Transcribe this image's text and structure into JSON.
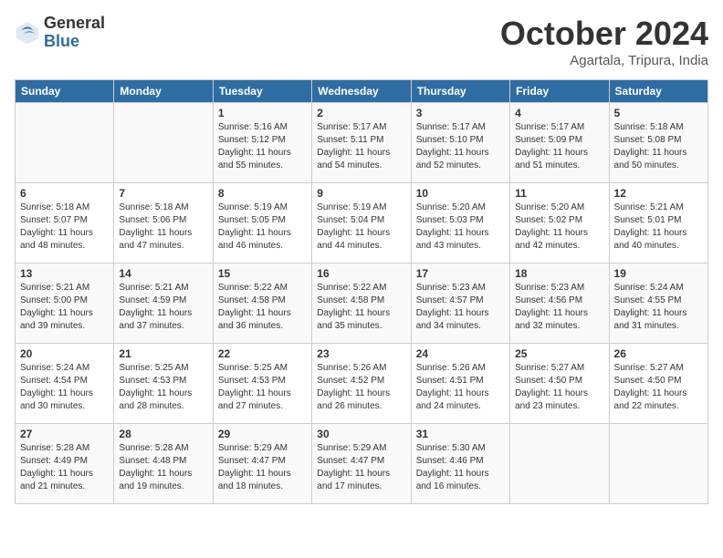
{
  "header": {
    "logo_general": "General",
    "logo_blue": "Blue",
    "month_title": "October 2024",
    "subtitle": "Agartala, Tripura, India"
  },
  "days_of_week": [
    "Sunday",
    "Monday",
    "Tuesday",
    "Wednesday",
    "Thursday",
    "Friday",
    "Saturday"
  ],
  "weeks": [
    [
      {
        "day": "",
        "content": ""
      },
      {
        "day": "",
        "content": ""
      },
      {
        "day": "1",
        "content": "Sunrise: 5:16 AM\nSunset: 5:12 PM\nDaylight: 11 hours and 55 minutes."
      },
      {
        "day": "2",
        "content": "Sunrise: 5:17 AM\nSunset: 5:11 PM\nDaylight: 11 hours and 54 minutes."
      },
      {
        "day": "3",
        "content": "Sunrise: 5:17 AM\nSunset: 5:10 PM\nDaylight: 11 hours and 52 minutes."
      },
      {
        "day": "4",
        "content": "Sunrise: 5:17 AM\nSunset: 5:09 PM\nDaylight: 11 hours and 51 minutes."
      },
      {
        "day": "5",
        "content": "Sunrise: 5:18 AM\nSunset: 5:08 PM\nDaylight: 11 hours and 50 minutes."
      }
    ],
    [
      {
        "day": "6",
        "content": "Sunrise: 5:18 AM\nSunset: 5:07 PM\nDaylight: 11 hours and 48 minutes."
      },
      {
        "day": "7",
        "content": "Sunrise: 5:18 AM\nSunset: 5:06 PM\nDaylight: 11 hours and 47 minutes."
      },
      {
        "day": "8",
        "content": "Sunrise: 5:19 AM\nSunset: 5:05 PM\nDaylight: 11 hours and 46 minutes."
      },
      {
        "day": "9",
        "content": "Sunrise: 5:19 AM\nSunset: 5:04 PM\nDaylight: 11 hours and 44 minutes."
      },
      {
        "day": "10",
        "content": "Sunrise: 5:20 AM\nSunset: 5:03 PM\nDaylight: 11 hours and 43 minutes."
      },
      {
        "day": "11",
        "content": "Sunrise: 5:20 AM\nSunset: 5:02 PM\nDaylight: 11 hours and 42 minutes."
      },
      {
        "day": "12",
        "content": "Sunrise: 5:21 AM\nSunset: 5:01 PM\nDaylight: 11 hours and 40 minutes."
      }
    ],
    [
      {
        "day": "13",
        "content": "Sunrise: 5:21 AM\nSunset: 5:00 PM\nDaylight: 11 hours and 39 minutes."
      },
      {
        "day": "14",
        "content": "Sunrise: 5:21 AM\nSunset: 4:59 PM\nDaylight: 11 hours and 37 minutes."
      },
      {
        "day": "15",
        "content": "Sunrise: 5:22 AM\nSunset: 4:58 PM\nDaylight: 11 hours and 36 minutes."
      },
      {
        "day": "16",
        "content": "Sunrise: 5:22 AM\nSunset: 4:58 PM\nDaylight: 11 hours and 35 minutes."
      },
      {
        "day": "17",
        "content": "Sunrise: 5:23 AM\nSunset: 4:57 PM\nDaylight: 11 hours and 34 minutes."
      },
      {
        "day": "18",
        "content": "Sunrise: 5:23 AM\nSunset: 4:56 PM\nDaylight: 11 hours and 32 minutes."
      },
      {
        "day": "19",
        "content": "Sunrise: 5:24 AM\nSunset: 4:55 PM\nDaylight: 11 hours and 31 minutes."
      }
    ],
    [
      {
        "day": "20",
        "content": "Sunrise: 5:24 AM\nSunset: 4:54 PM\nDaylight: 11 hours and 30 minutes."
      },
      {
        "day": "21",
        "content": "Sunrise: 5:25 AM\nSunset: 4:53 PM\nDaylight: 11 hours and 28 minutes."
      },
      {
        "day": "22",
        "content": "Sunrise: 5:25 AM\nSunset: 4:53 PM\nDaylight: 11 hours and 27 minutes."
      },
      {
        "day": "23",
        "content": "Sunrise: 5:26 AM\nSunset: 4:52 PM\nDaylight: 11 hours and 26 minutes."
      },
      {
        "day": "24",
        "content": "Sunrise: 5:26 AM\nSunset: 4:51 PM\nDaylight: 11 hours and 24 minutes."
      },
      {
        "day": "25",
        "content": "Sunrise: 5:27 AM\nSunset: 4:50 PM\nDaylight: 11 hours and 23 minutes."
      },
      {
        "day": "26",
        "content": "Sunrise: 5:27 AM\nSunset: 4:50 PM\nDaylight: 11 hours and 22 minutes."
      }
    ],
    [
      {
        "day": "27",
        "content": "Sunrise: 5:28 AM\nSunset: 4:49 PM\nDaylight: 11 hours and 21 minutes."
      },
      {
        "day": "28",
        "content": "Sunrise: 5:28 AM\nSunset: 4:48 PM\nDaylight: 11 hours and 19 minutes."
      },
      {
        "day": "29",
        "content": "Sunrise: 5:29 AM\nSunset: 4:47 PM\nDaylight: 11 hours and 18 minutes."
      },
      {
        "day": "30",
        "content": "Sunrise: 5:29 AM\nSunset: 4:47 PM\nDaylight: 11 hours and 17 minutes."
      },
      {
        "day": "31",
        "content": "Sunrise: 5:30 AM\nSunset: 4:46 PM\nDaylight: 11 hours and 16 minutes."
      },
      {
        "day": "",
        "content": ""
      },
      {
        "day": "",
        "content": ""
      }
    ]
  ]
}
